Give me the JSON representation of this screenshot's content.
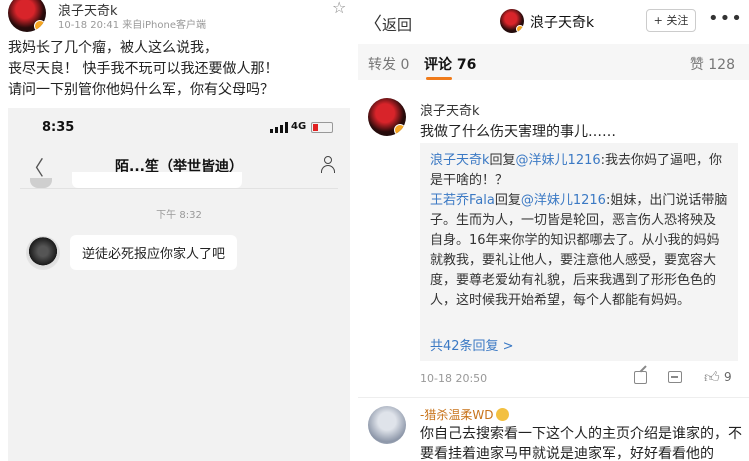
{
  "left": {
    "author": "浪子天奇k",
    "meta": "10-18 20:41  来自iPhone客户端",
    "post_lines": [
      "我妈长了几个瘤，被人这么说我，",
      "丧尽天良！ 快手我不玩可以我还要做人那！",
      "请问一下别管你他妈什么军，你有父母吗？"
    ],
    "phone": {
      "time": "8:35",
      "network": "4G",
      "chat_title": "陌...笙（举世皆迪）",
      "timestamp": "下午 8:32",
      "message": "逆徒必死报应你家人了吧"
    }
  },
  "right": {
    "back_label": "返回",
    "header_name": "浪子天奇k",
    "follow_label": "+ 关注",
    "tabs": {
      "repost": "转发 0",
      "comment": "评论 76",
      "like": "赞 128"
    },
    "comment1": {
      "name": "浪子天奇k",
      "text": "我做了什么伤天害理的事儿……",
      "reply1_user": "浪子天奇k",
      "reply1_mid": "回复",
      "reply1_target": "@洋妹儿1216",
      "reply1_text": ":我去你妈了逼吧，你是干啥的！？",
      "reply2_user": "王若乔Fala",
      "reply2_mid": "回复",
      "reply2_target": "@洋妹儿1216",
      "reply2_text": ":姐妹，出门说话带脑子。生而为人，一切皆是轮回，恶言伤人恐将殃及自身。16年来你学的知识都哪去了。从小我的妈妈就教我，要礼让他人，要注意他人感受，要宽容大度，要尊老爱幼有礼貌，后来我遇到了形形色色的人，这时候我开始希望，每个人都能有妈妈。",
      "more_replies": "共42条回复 >",
      "time": "10-18 20:50",
      "likes": "9"
    },
    "comment2": {
      "name": "-猎杀温柔WD",
      "text": "你自己去搜索看一下这个人的主页介绍是谁家的，不要看挂着迪家马甲就说是迪家军，好好看看他的"
    }
  }
}
